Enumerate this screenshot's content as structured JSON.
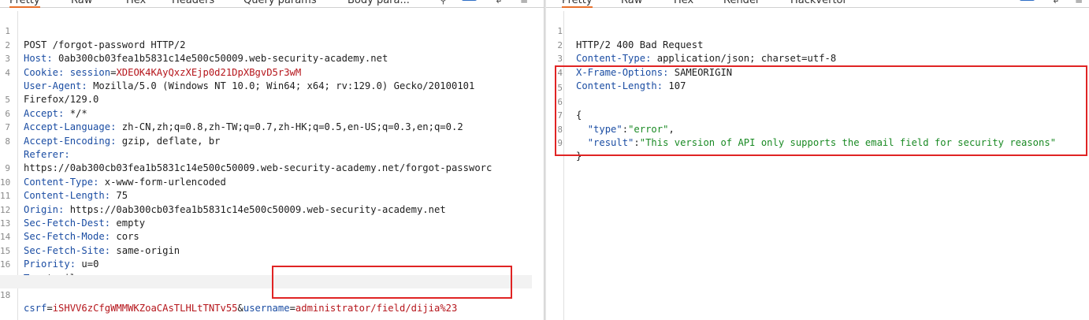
{
  "request": {
    "tabs": [
      "Pretty",
      "Raw",
      "Hex",
      "Headers",
      "Query params",
      "Body para..."
    ],
    "lines": [
      {
        "n": "1",
        "text": "POST /forgot-password HTTP/2"
      },
      {
        "n": "2",
        "key": "Host",
        "value": "0ab300cb03fea1b5831c14e500c50009.web-security-academy.net"
      },
      {
        "n": "3",
        "key": "Cookie",
        "cookie_name": "session",
        "cookie_value": "XDEOK4KAyQxzXEjp0d21DpXBgvD5r3wM"
      },
      {
        "n": "4",
        "key": "User-Agent",
        "value": "Mozilla/5.0 (Windows NT 10.0; Win64; x64; rv:129.0) Gecko/20100101"
      },
      {
        "n": "",
        "text": "Firefox/129.0"
      },
      {
        "n": "5",
        "key": "Accept",
        "value": "*/*"
      },
      {
        "n": "6",
        "key": "Accept-Language",
        "value": "zh-CN,zh;q=0.8,zh-TW;q=0.7,zh-HK;q=0.5,en-US;q=0.3,en;q=0.2"
      },
      {
        "n": "7",
        "key": "Accept-Encoding",
        "value": "gzip, deflate, br"
      },
      {
        "n": "8",
        "key": "Referer",
        "value": ""
      },
      {
        "n": "",
        "text": "https://0ab300cb03fea1b5831c14e500c50009.web-security-academy.net/forgot-passworc"
      },
      {
        "n": "9",
        "key": "Content-Type",
        "value": "x-www-form-urlencoded"
      },
      {
        "n": "10",
        "key": "Content-Length",
        "value": "75"
      },
      {
        "n": "11",
        "key": "Origin",
        "value": "https://0ab300cb03fea1b5831c14e500c50009.web-security-academy.net"
      },
      {
        "n": "12",
        "key": "Sec-Fetch-Dest",
        "value": "empty"
      },
      {
        "n": "13",
        "key": "Sec-Fetch-Mode",
        "value": "cors"
      },
      {
        "n": "14",
        "key": "Sec-Fetch-Site",
        "value": "same-origin"
      },
      {
        "n": "15",
        "key": "Priority",
        "value": "u=0"
      },
      {
        "n": "16",
        "key": "Te",
        "value": "trailers"
      },
      {
        "n": "17",
        "text": ""
      }
    ],
    "body": {
      "n": "18",
      "csrf_name": "csrf",
      "csrf_value": "iSHVV6zCfgWMMWKZoaCAsTLHLtTNTv55",
      "amp": "&",
      "user_name": "username",
      "user_value": "administrator/field/dijia%23"
    }
  },
  "response": {
    "tabs": [
      "Pretty",
      "Raw",
      "Hex",
      "Render",
      "Hackvertor"
    ],
    "lines": [
      {
        "n": "1",
        "text": "HTTP/2 400 Bad Request"
      },
      {
        "n": "2",
        "key": "Content-Type",
        "value": "application/json; charset=utf-8"
      },
      {
        "n": "3",
        "key": "X-Frame-Options",
        "value": "SAMEORIGIN"
      },
      {
        "n": "4",
        "key": "Content-Length",
        "value": "107"
      }
    ],
    "json": {
      "blank_n": "5",
      "open_n": "6",
      "open": "{",
      "type_n": "7",
      "type_key": "\"type\"",
      "type_value": "\"error\"",
      "result_n": "8",
      "result_key": "\"result\"",
      "result_value": "\"This version of API only supports the email field for security reasons\"",
      "close_n": "9",
      "close": "}"
    }
  },
  "colors": {
    "header_key": "#1b4da3",
    "string_value": "#b5151b",
    "json_string": "#1a8a24",
    "highlight_box": "#e02424"
  }
}
